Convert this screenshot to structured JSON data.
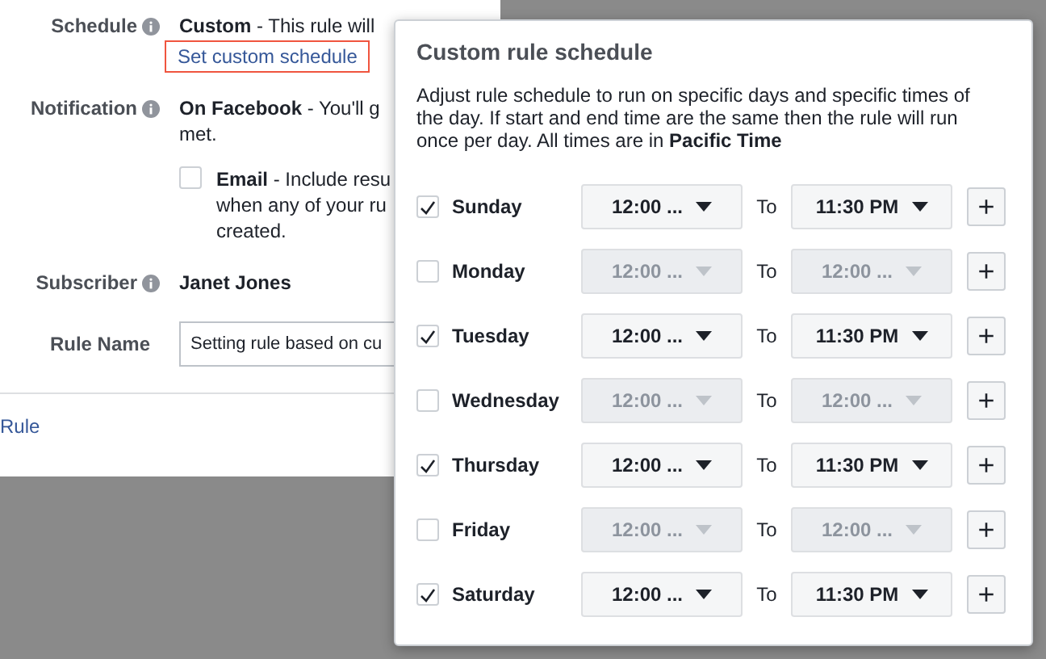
{
  "form": {
    "schedule": {
      "label": "Schedule",
      "value_bold": "Custom",
      "value_rest": " - This rule will",
      "link": "Set custom schedule",
      "link_highlighted": true
    },
    "notification": {
      "label": "Notification",
      "value_bold": "On Facebook",
      "value_rest": " - You'll g",
      "value_line2": "met.",
      "email": {
        "checked": false,
        "bold": "Email",
        "lines": [
          " - Include resu",
          "when any of your ru",
          "created."
        ]
      }
    },
    "subscriber": {
      "label": "Subscriber",
      "value": "Janet Jones"
    },
    "rule_name": {
      "label": "Rule Name",
      "value": "Setting rule based on cu"
    },
    "footer_link": "Rule"
  },
  "popover": {
    "title": "Custom rule schedule",
    "description": "Adjust rule schedule to run on specific days and specific times of the day. If start and end time are the same then the rule will run once per day. All times are in **Pacific Time**",
    "plus": "+",
    "days": [
      {
        "day": "Sunday",
        "checked": true,
        "start": "12:00 ...",
        "to": "To",
        "end": "11:30 PM"
      },
      {
        "day": "Monday",
        "checked": false,
        "start": "12:00 ...",
        "to": "To",
        "end": "12:00 ..."
      },
      {
        "day": "Tuesday",
        "checked": true,
        "start": "12:00 ...",
        "to": "To",
        "end": "11:30 PM"
      },
      {
        "day": "Wednesday",
        "checked": false,
        "start": "12:00 ...",
        "to": "To",
        "end": "12:00 ..."
      },
      {
        "day": "Thursday",
        "checked": true,
        "start": "12:00 ...",
        "to": "To",
        "end": "11:30 PM"
      },
      {
        "day": "Friday",
        "checked": false,
        "start": "12:00 ...",
        "to": "To",
        "end": "12:00 ..."
      },
      {
        "day": "Saturday",
        "checked": true,
        "start": "12:00 ...",
        "to": "To",
        "end": "11:30 PM"
      }
    ]
  }
}
